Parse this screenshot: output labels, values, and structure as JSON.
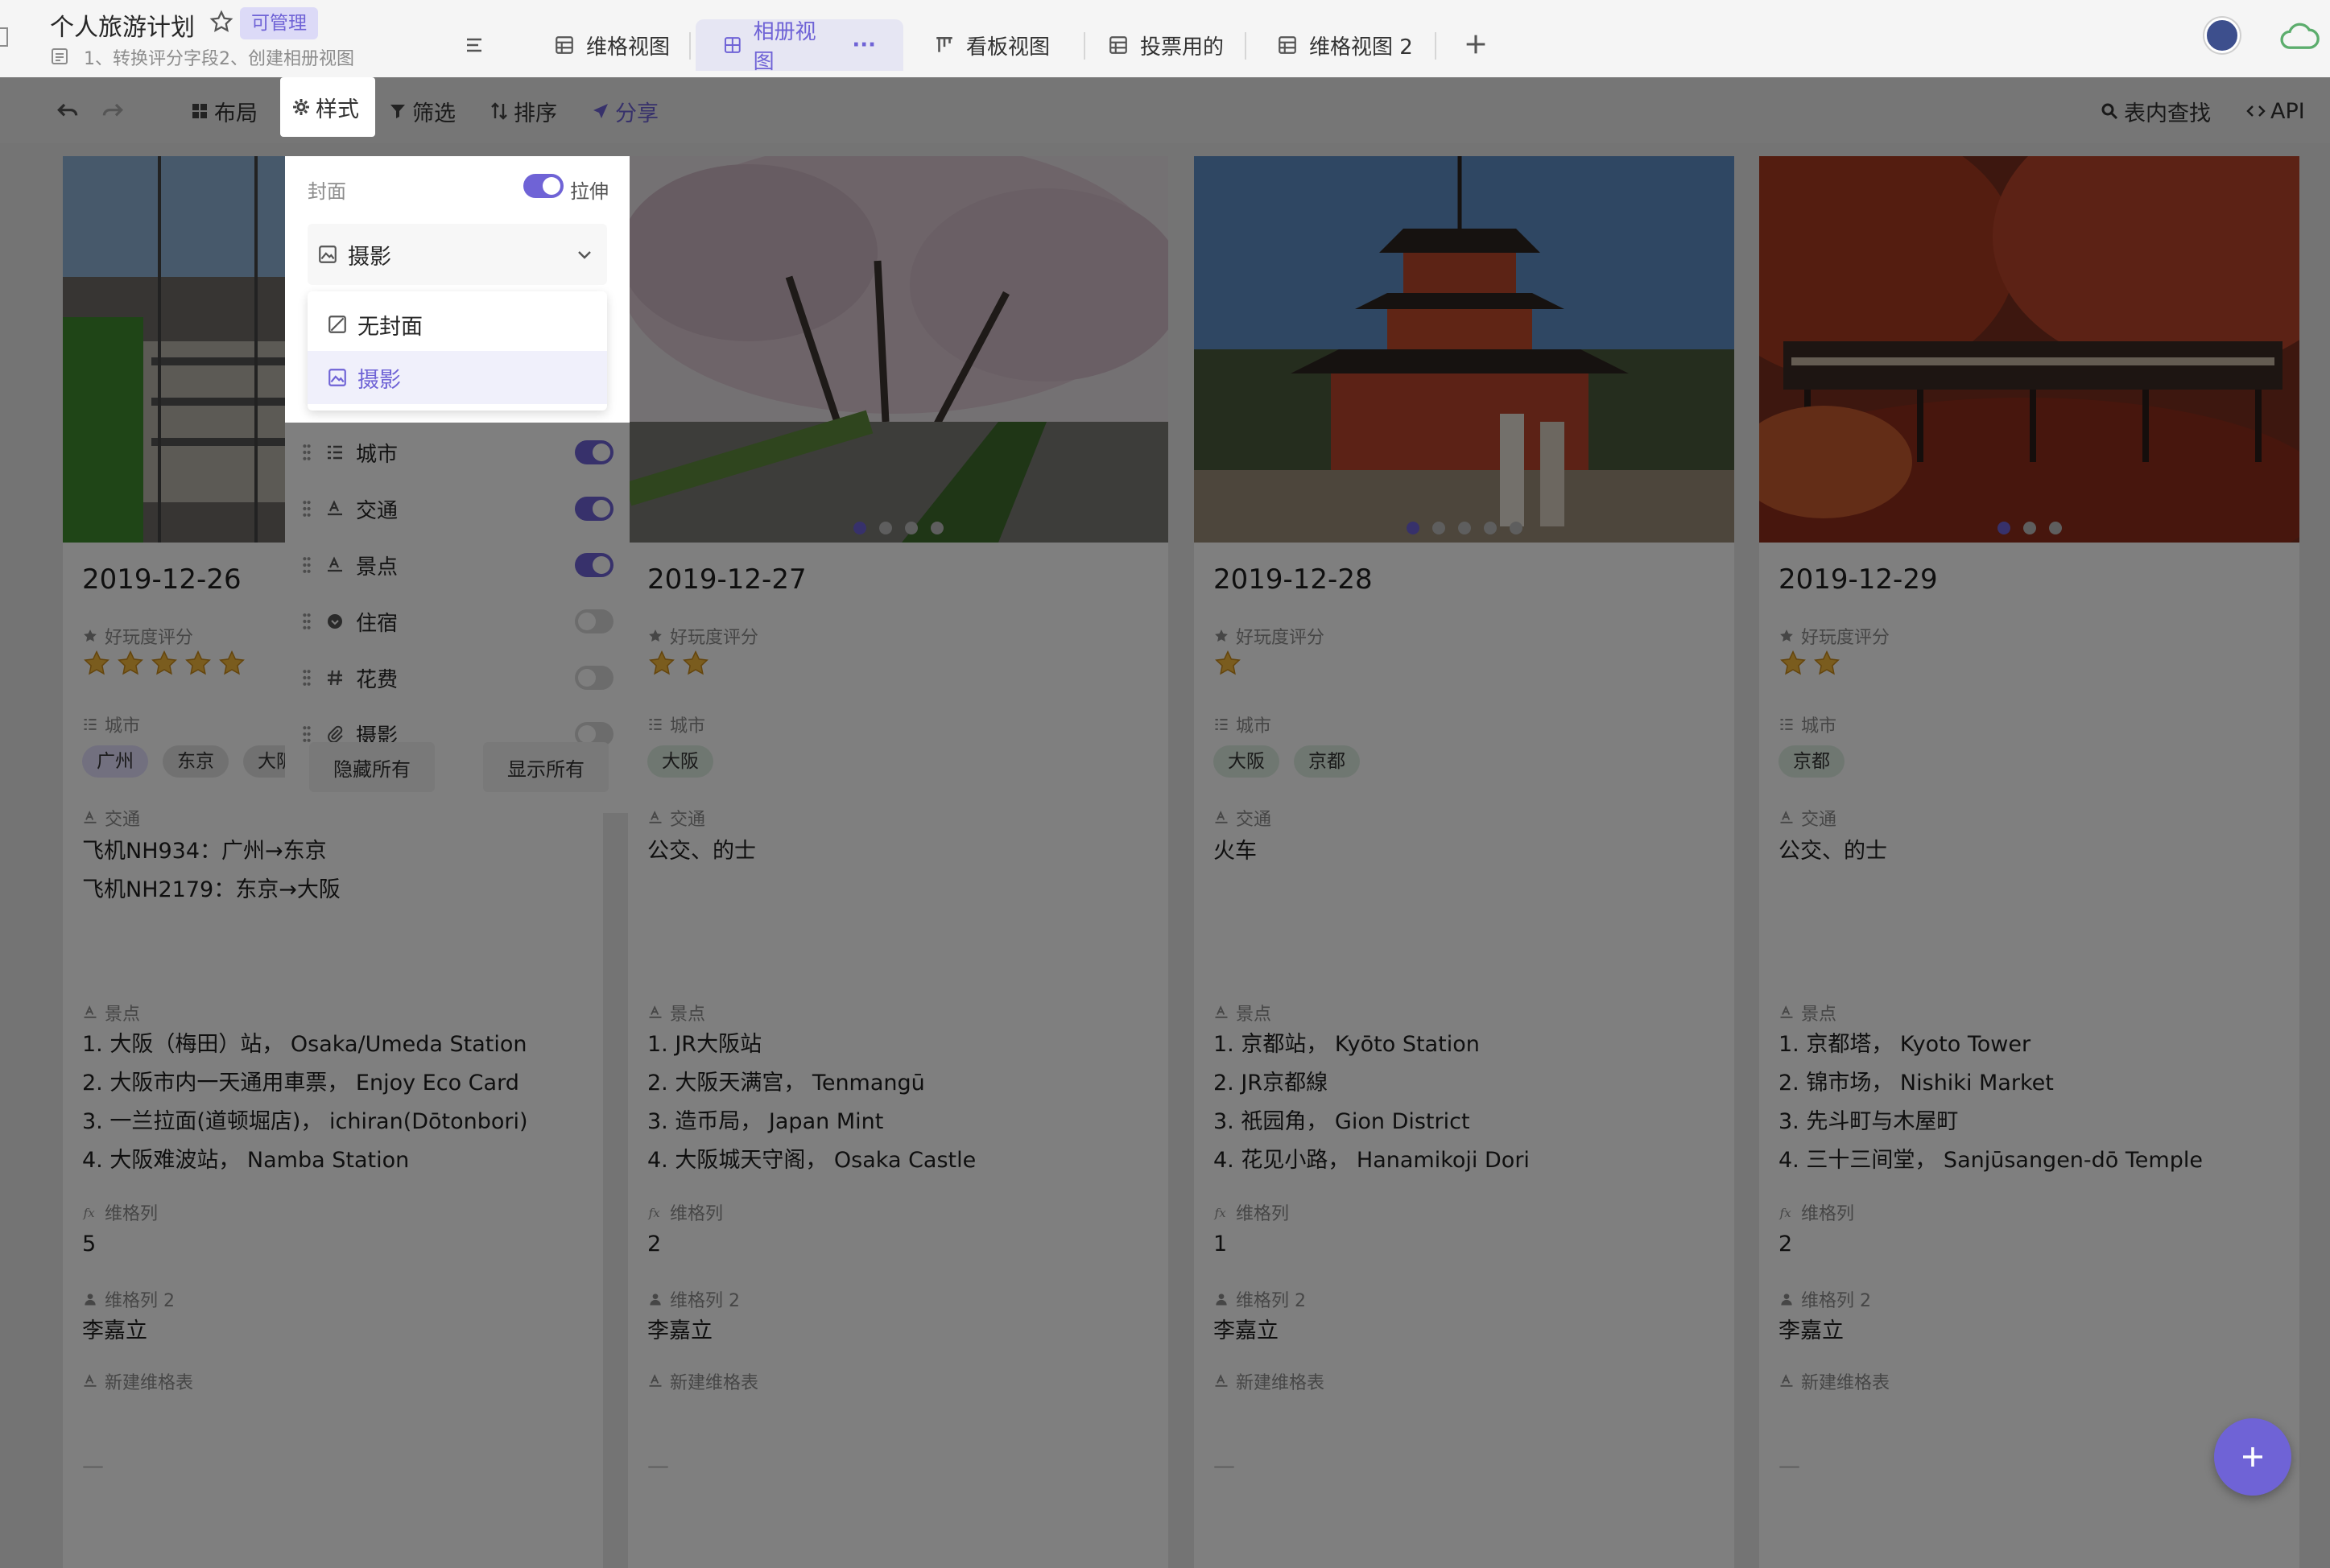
{
  "header": {
    "title": "个人旅游计划",
    "permission_badge": "可管理",
    "description": "1、转换评分字段2、创建相册视图"
  },
  "view_tabs": [
    {
      "label": "维格视图",
      "icon": "grid-view-icon",
      "active": false
    },
    {
      "label": "相册视图",
      "icon": "gallery-view-icon",
      "active": true,
      "more": "···"
    },
    {
      "label": "看板视图",
      "icon": "kanban-view-icon",
      "active": false
    },
    {
      "label": "投票用的",
      "icon": "grid-view-icon",
      "active": false
    },
    {
      "label": "维格视图 2",
      "icon": "grid-view-icon",
      "active": false
    }
  ],
  "toolbar": {
    "layout_label": "布局",
    "style_label": "样式",
    "filter_label": "筛选",
    "sort_label": "排序",
    "share_label": "分享",
    "search_label": "表内查找",
    "api_label": "API"
  },
  "style_panel": {
    "cover_label": "封面",
    "stretch_label": "拉伸",
    "stretch_on": true,
    "selected_cover": "摄影",
    "dropdown_options": [
      "无封面",
      "摄影"
    ],
    "fields": [
      {
        "label": "城市",
        "icon": "multiselect-icon",
        "visible": true
      },
      {
        "label": "交通",
        "icon": "text-field-icon",
        "visible": true
      },
      {
        "label": "景点",
        "icon": "text-field-icon",
        "visible": true
      },
      {
        "label": "住宿",
        "icon": "single-select-icon",
        "visible": false
      },
      {
        "label": "花费",
        "icon": "number-field-icon",
        "visible": false
      },
      {
        "label": "摄影",
        "icon": "attachment-icon",
        "visible": false
      }
    ],
    "hide_all_label": "隐藏所有",
    "show_all_label": "显示所有"
  },
  "field_labels": {
    "rating": "好玩度评分",
    "city": "城市",
    "transport": "交通",
    "spots": "景点",
    "formula": "维格列",
    "member": "维格列 2",
    "link": "新建维格表"
  },
  "cards": [
    {
      "date": "2019-12-26",
      "rating": 5,
      "cities": [
        "广州",
        "东京",
        "大阪"
      ],
      "transport": [
        "飞机NH934：广州→东京",
        "飞机NH2179：东京→大阪"
      ],
      "spots": [
        "1. 大阪（梅田）站， Osaka/Umeda Station",
        "2. 大阪市内一天通用車票， Enjoy Eco Card",
        "3. 一兰拉面(道顿堀店)， ichiran(Dōtonbori)",
        "4. 大阪难波站， Namba Station"
      ],
      "formula": "5",
      "member": "李嘉立",
      "link": "—",
      "photo_count": 0,
      "photo_index": 0
    },
    {
      "date": "2019-12-27",
      "rating": 2,
      "cities": [
        "大阪"
      ],
      "transport": [
        "公交、的士"
      ],
      "spots": [
        "1. JR大阪站",
        "2. 大阪天满宫， Tenmangū",
        "3. 造币局， Japan Mint",
        "4. 大阪城天守阁， Osaka Castle"
      ],
      "formula": "2",
      "member": "李嘉立",
      "link": "—",
      "photo_count": 4,
      "photo_index": 0
    },
    {
      "date": "2019-12-28",
      "rating": 1,
      "cities": [
        "大阪",
        "京都"
      ],
      "transport": [
        "火车"
      ],
      "spots": [
        "1. 京都站， Kyōto Station",
        "2. JR京都線",
        "3. 祇园角， Gion District",
        "4. 花见小路， Hanamikoji Dori"
      ],
      "formula": "1",
      "member": "李嘉立",
      "link": "—",
      "photo_count": 5,
      "photo_index": 0
    },
    {
      "date": "2019-12-29",
      "rating": 2,
      "cities": [
        "京都"
      ],
      "transport": [
        "公交、的士"
      ],
      "spots": [
        "1. 京都塔， Kyoto Tower",
        "2. 锦市场， Nishiki Market",
        "3. 先斗町与木屋町",
        "4. 三十三间堂， Sanjūsangen-dō Temple"
      ],
      "formula": "2",
      "member": "李嘉立",
      "link": "—",
      "photo_count": 3,
      "photo_index": 0
    }
  ],
  "colors": {
    "accent": "#6f63d6",
    "star": "#f5b93c"
  }
}
